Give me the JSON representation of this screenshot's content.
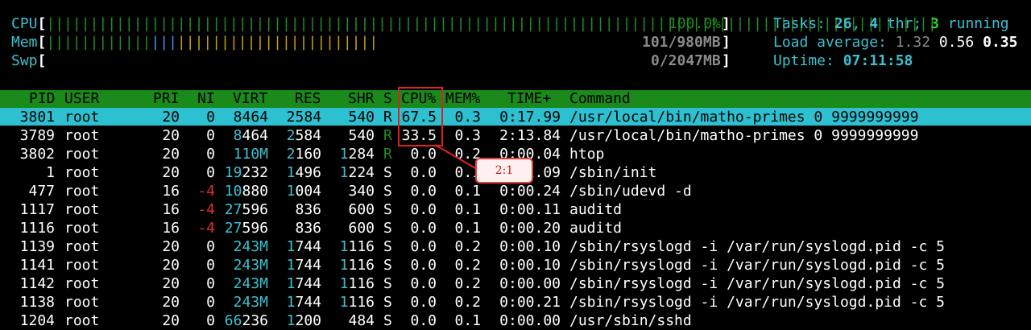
{
  "meters": {
    "cpu": {
      "label": "CPU",
      "bars": "||||||||||||||||||||||||||||||||||||||||||||||||||||||||||||||||||||||||||||||||||||||||||||||||||||||",
      "value": "100.0%"
    },
    "mem": {
      "label": "Mem",
      "bars_green": "||||||||||||",
      "bars_blue": "|||",
      "bars_yellow": "|||||||||||||||||||||||",
      "value": "101/980MB"
    },
    "swp": {
      "label": "Swp",
      "value": "0/2047MB"
    }
  },
  "summary": {
    "tasks_label": "Tasks: ",
    "tasks": "26",
    "thr_sep": ", ",
    "thr": "4",
    "thr_label": " thr; ",
    "running": "3",
    "running_label": " running",
    "load_label": "Load average: ",
    "load1": "1.32",
    "load5": "0.56",
    "load15": "0.35",
    "uptime_label": "Uptime: ",
    "uptime": "07:11:58"
  },
  "columns": {
    "pid": "PID",
    "user": "USER",
    "pri": "PRI",
    "ni": "NI",
    "virt": "VIRT",
    "res": "RES",
    "shr": "SHR",
    "s": "S",
    "cpu": "CPU%",
    "mem": "MEM%",
    "time": "TIME+",
    "command": "Command"
  },
  "processes": [
    {
      "pid": "3801",
      "user": "root",
      "pri": "20",
      "ni": "0",
      "virt": "8464",
      "res": "2584",
      "shr": "540",
      "s": "R",
      "cpu": "67.5",
      "mem": "0.3",
      "time": "0:17.99",
      "command": "/usr/local/bin/matho-primes 0 9999999999"
    },
    {
      "pid": "3789",
      "user": "root",
      "pri": "20",
      "ni": "0",
      "virt": "8464",
      "res": "2584",
      "shr": "540",
      "s": "R",
      "cpu": "33.5",
      "mem": "0.3",
      "time": "2:13.84",
      "command": "/usr/local/bin/matho-primes 0 9999999999"
    },
    {
      "pid": "3802",
      "user": "root",
      "pri": "20",
      "ni": "0",
      "virt": "110M",
      "res": "2160",
      "shr": "1284",
      "s": "R",
      "cpu": "0.0",
      "mem": "0.2",
      "time": "0:00.04",
      "command": "htop"
    },
    {
      "pid": "1",
      "user": "root",
      "pri": "20",
      "ni": "0",
      "virt": "19232",
      "res": "1496",
      "shr": "1224",
      "s": "S",
      "cpu": "0.0",
      "mem": "0.1",
      "time": "0:01.09",
      "command": "/sbin/init"
    },
    {
      "pid": "477",
      "user": "root",
      "pri": "16",
      "ni": "-4",
      "virt": "10880",
      "res": "1004",
      "shr": "340",
      "s": "S",
      "cpu": "0.0",
      "mem": "0.1",
      "time": "0:00.24",
      "command": "/sbin/udevd -d"
    },
    {
      "pid": "1117",
      "user": "root",
      "pri": "16",
      "ni": "-4",
      "virt": "27596",
      "res": "836",
      "shr": "600",
      "s": "S",
      "cpu": "0.0",
      "mem": "0.1",
      "time": "0:00.11",
      "command": "auditd"
    },
    {
      "pid": "1116",
      "user": "root",
      "pri": "16",
      "ni": "-4",
      "virt": "27596",
      "res": "836",
      "shr": "600",
      "s": "S",
      "cpu": "0.0",
      "mem": "0.1",
      "time": "0:00.20",
      "command": "auditd"
    },
    {
      "pid": "1139",
      "user": "root",
      "pri": "20",
      "ni": "0",
      "virt": "243M",
      "res": "1744",
      "shr": "1116",
      "s": "S",
      "cpu": "0.0",
      "mem": "0.2",
      "time": "0:00.10",
      "command": "/sbin/rsyslogd -i /var/run/syslogd.pid -c 5"
    },
    {
      "pid": "1141",
      "user": "root",
      "pri": "20",
      "ni": "0",
      "virt": "243M",
      "res": "1744",
      "shr": "1116",
      "s": "S",
      "cpu": "0.0",
      "mem": "0.2",
      "time": "0:00.10",
      "command": "/sbin/rsyslogd -i /var/run/syslogd.pid -c 5"
    },
    {
      "pid": "1142",
      "user": "root",
      "pri": "20",
      "ni": "0",
      "virt": "243M",
      "res": "1744",
      "shr": "1116",
      "s": "S",
      "cpu": "0.0",
      "mem": "0.2",
      "time": "0:00.00",
      "command": "/sbin/rsyslogd -i /var/run/syslogd.pid -c 5"
    },
    {
      "pid": "1138",
      "user": "root",
      "pri": "20",
      "ni": "0",
      "virt": "243M",
      "res": "1744",
      "shr": "1116",
      "s": "S",
      "cpu": "0.0",
      "mem": "0.2",
      "time": "0:00.21",
      "command": "/sbin/rsyslogd -i /var/run/syslogd.pid -c 5"
    },
    {
      "pid": "1204",
      "user": "root",
      "pri": "20",
      "ni": "0",
      "virt": "66236",
      "res": "1200",
      "shr": "484",
      "s": "S",
      "cpu": "0.0",
      "mem": "0.1",
      "time": "0:00.00",
      "command": "/usr/sbin/sshd"
    }
  ],
  "annotation": {
    "callout": "2:1"
  },
  "colors": {
    "header_bg": "#1a8a1a",
    "selected_bg": "#2cc0d0",
    "annotation": "#e02020",
    "cyan": "#3cc0d0",
    "green": "#2fcf2f"
  }
}
